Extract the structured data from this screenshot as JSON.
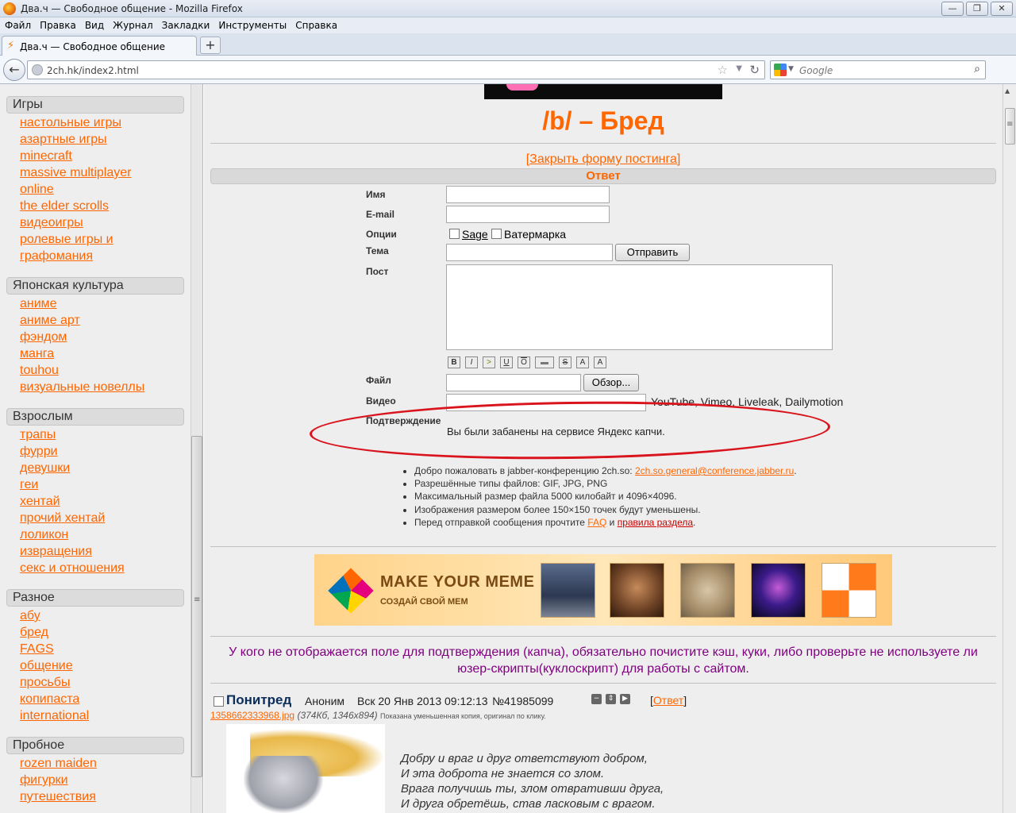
{
  "window": {
    "title": "Два.ч — Свободное общение - Mozilla Firefox",
    "controls": [
      "—",
      "❐",
      "✕"
    ]
  },
  "menu": [
    "Файл",
    "Правка",
    "Вид",
    "Журнал",
    "Закладки",
    "Инструменты",
    "Справка"
  ],
  "tab": {
    "label": "Два.ч — Свободное общение",
    "new_tab": "+"
  },
  "nav": {
    "url": "2ch.hk/index2.html",
    "search_placeholder": "Google"
  },
  "sidebar": [
    {
      "title": "Игры",
      "links": [
        "настольные игры",
        "азартные игры",
        "minecraft",
        "massive multiplayer",
        "online",
        "the elder scrolls",
        "видеоигры",
        "ролевые игры и",
        "графомания"
      ]
    },
    {
      "title": "Японская культура",
      "links": [
        "аниме",
        "аниме арт",
        "фэндом",
        "манга",
        "touhou",
        "визуальные новеллы"
      ]
    },
    {
      "title": "Взрослым",
      "links": [
        "трапы",
        "фурри",
        "девушки",
        "геи",
        "хентай",
        "прочий хентай",
        "лоликон",
        "извращения",
        "секс и отношения"
      ]
    },
    {
      "title": "Разное",
      "links": [
        "абу",
        "бред",
        "FAGS",
        "общение",
        "просьбы",
        "копипаста",
        "international"
      ]
    },
    {
      "title": "Пробное",
      "links": [
        "rozen maiden",
        "фигурки",
        "путешествия"
      ]
    }
  ],
  "board": {
    "title": "/b/ – Бред",
    "close_form": "[Закрыть форму постинга]",
    "reply_header": "Ответ"
  },
  "form": {
    "name_label": "Имя",
    "email_label": "E-mail",
    "options_label": "Опции",
    "sage_label": "Sage",
    "watermark_label": "Ватермарка",
    "subject_label": "Тема",
    "submit_label": "Отправить",
    "post_label": "Пост",
    "file_label": "Файл",
    "browse_label": "Обзор...",
    "video_label": "Видео",
    "video_hint": "YouTube, Vimeo, Liveleak, Dailymotion",
    "captcha_label": "Подтверждение",
    "captcha_message": "Вы были забанены на сервисе Яндекс капчи.",
    "format_buttons": [
      "B",
      "I",
      ">",
      "U",
      "O",
      "▬",
      "S",
      "A",
      "A"
    ]
  },
  "rules": {
    "jabber_text": "Добро пожаловать в jabber-конференцию 2ch.so:",
    "jabber_link": "2ch.so.general@conference.jabber.ru",
    "jabber_dot": ".",
    "file_types": "Разрешённые типы файлов: GIF, JPG, PNG",
    "max_size": "Максимальный размер файла 5000 килобайт и 4096×4096.",
    "thumb_info": "Изображения размером более 150×150 точек будут уменьшены.",
    "read_before": "Перед отправкой сообщения прочтите",
    "faq_link": "FAQ",
    "and": "и",
    "rules_link": "правила раздела",
    "end_dot": "."
  },
  "ad": {
    "title": "MAKE YOUR MEME",
    "subtitle": "СОЗДАЙ СВОЙ МЕМ"
  },
  "captcha_note": "У кого не отображается поле для подтверждения (капча), обязательно почистите кэш, куки, либо проверьте не используете ли юзер-скрипты(куклоскрипт) для работы с сайтом.",
  "post": {
    "subject": "Понитред",
    "author": "Аноним",
    "date": "Вск 20 Янв 2013 09:12:13",
    "number": "№41985099",
    "reply_open": "[",
    "reply_link": "Ответ",
    "reply_close": "]",
    "file_name": "1358662333968.jpg",
    "file_info": "(374Кб, 1346x894)",
    "thumb_note": "Показана уменьшенная копия, оригинал по клику.",
    "text_lines": [
      "Добру и враг и друг ответствуют добром,",
      "И эта доброта не знается со злом.",
      "Врага получишь ты, злом отвративши друга,",
      "И друга обретёшь, став ласковым с врагом."
    ]
  },
  "colors": {
    "accent": "#ff6600",
    "annotation": "#d9141c",
    "note": "#800080",
    "subject": "#0b2d5a"
  }
}
